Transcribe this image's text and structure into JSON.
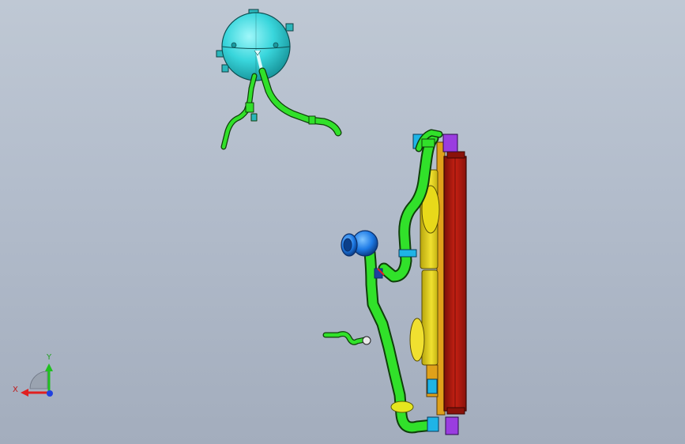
{
  "viewport": {
    "background_top": "#bfc8d4",
    "background_bottom": "#a3adbd"
  },
  "model": {
    "colors": {
      "tank": "#39d6dc",
      "hose": "#31e12a",
      "radiator_core": "#b21a0f",
      "radiator_frame": "#e0a11a",
      "shroud": "#e8d91a",
      "pump": "#1e7be6",
      "clamp": "#1eb4e6",
      "bracket": "#9a3de0",
      "yellow_clamp": "#e6e61e"
    }
  },
  "triad": {
    "x_label": "X",
    "y_label": "Y",
    "x_color": "#e02020",
    "y_color": "#20c020",
    "z_color": "#2040e0"
  }
}
